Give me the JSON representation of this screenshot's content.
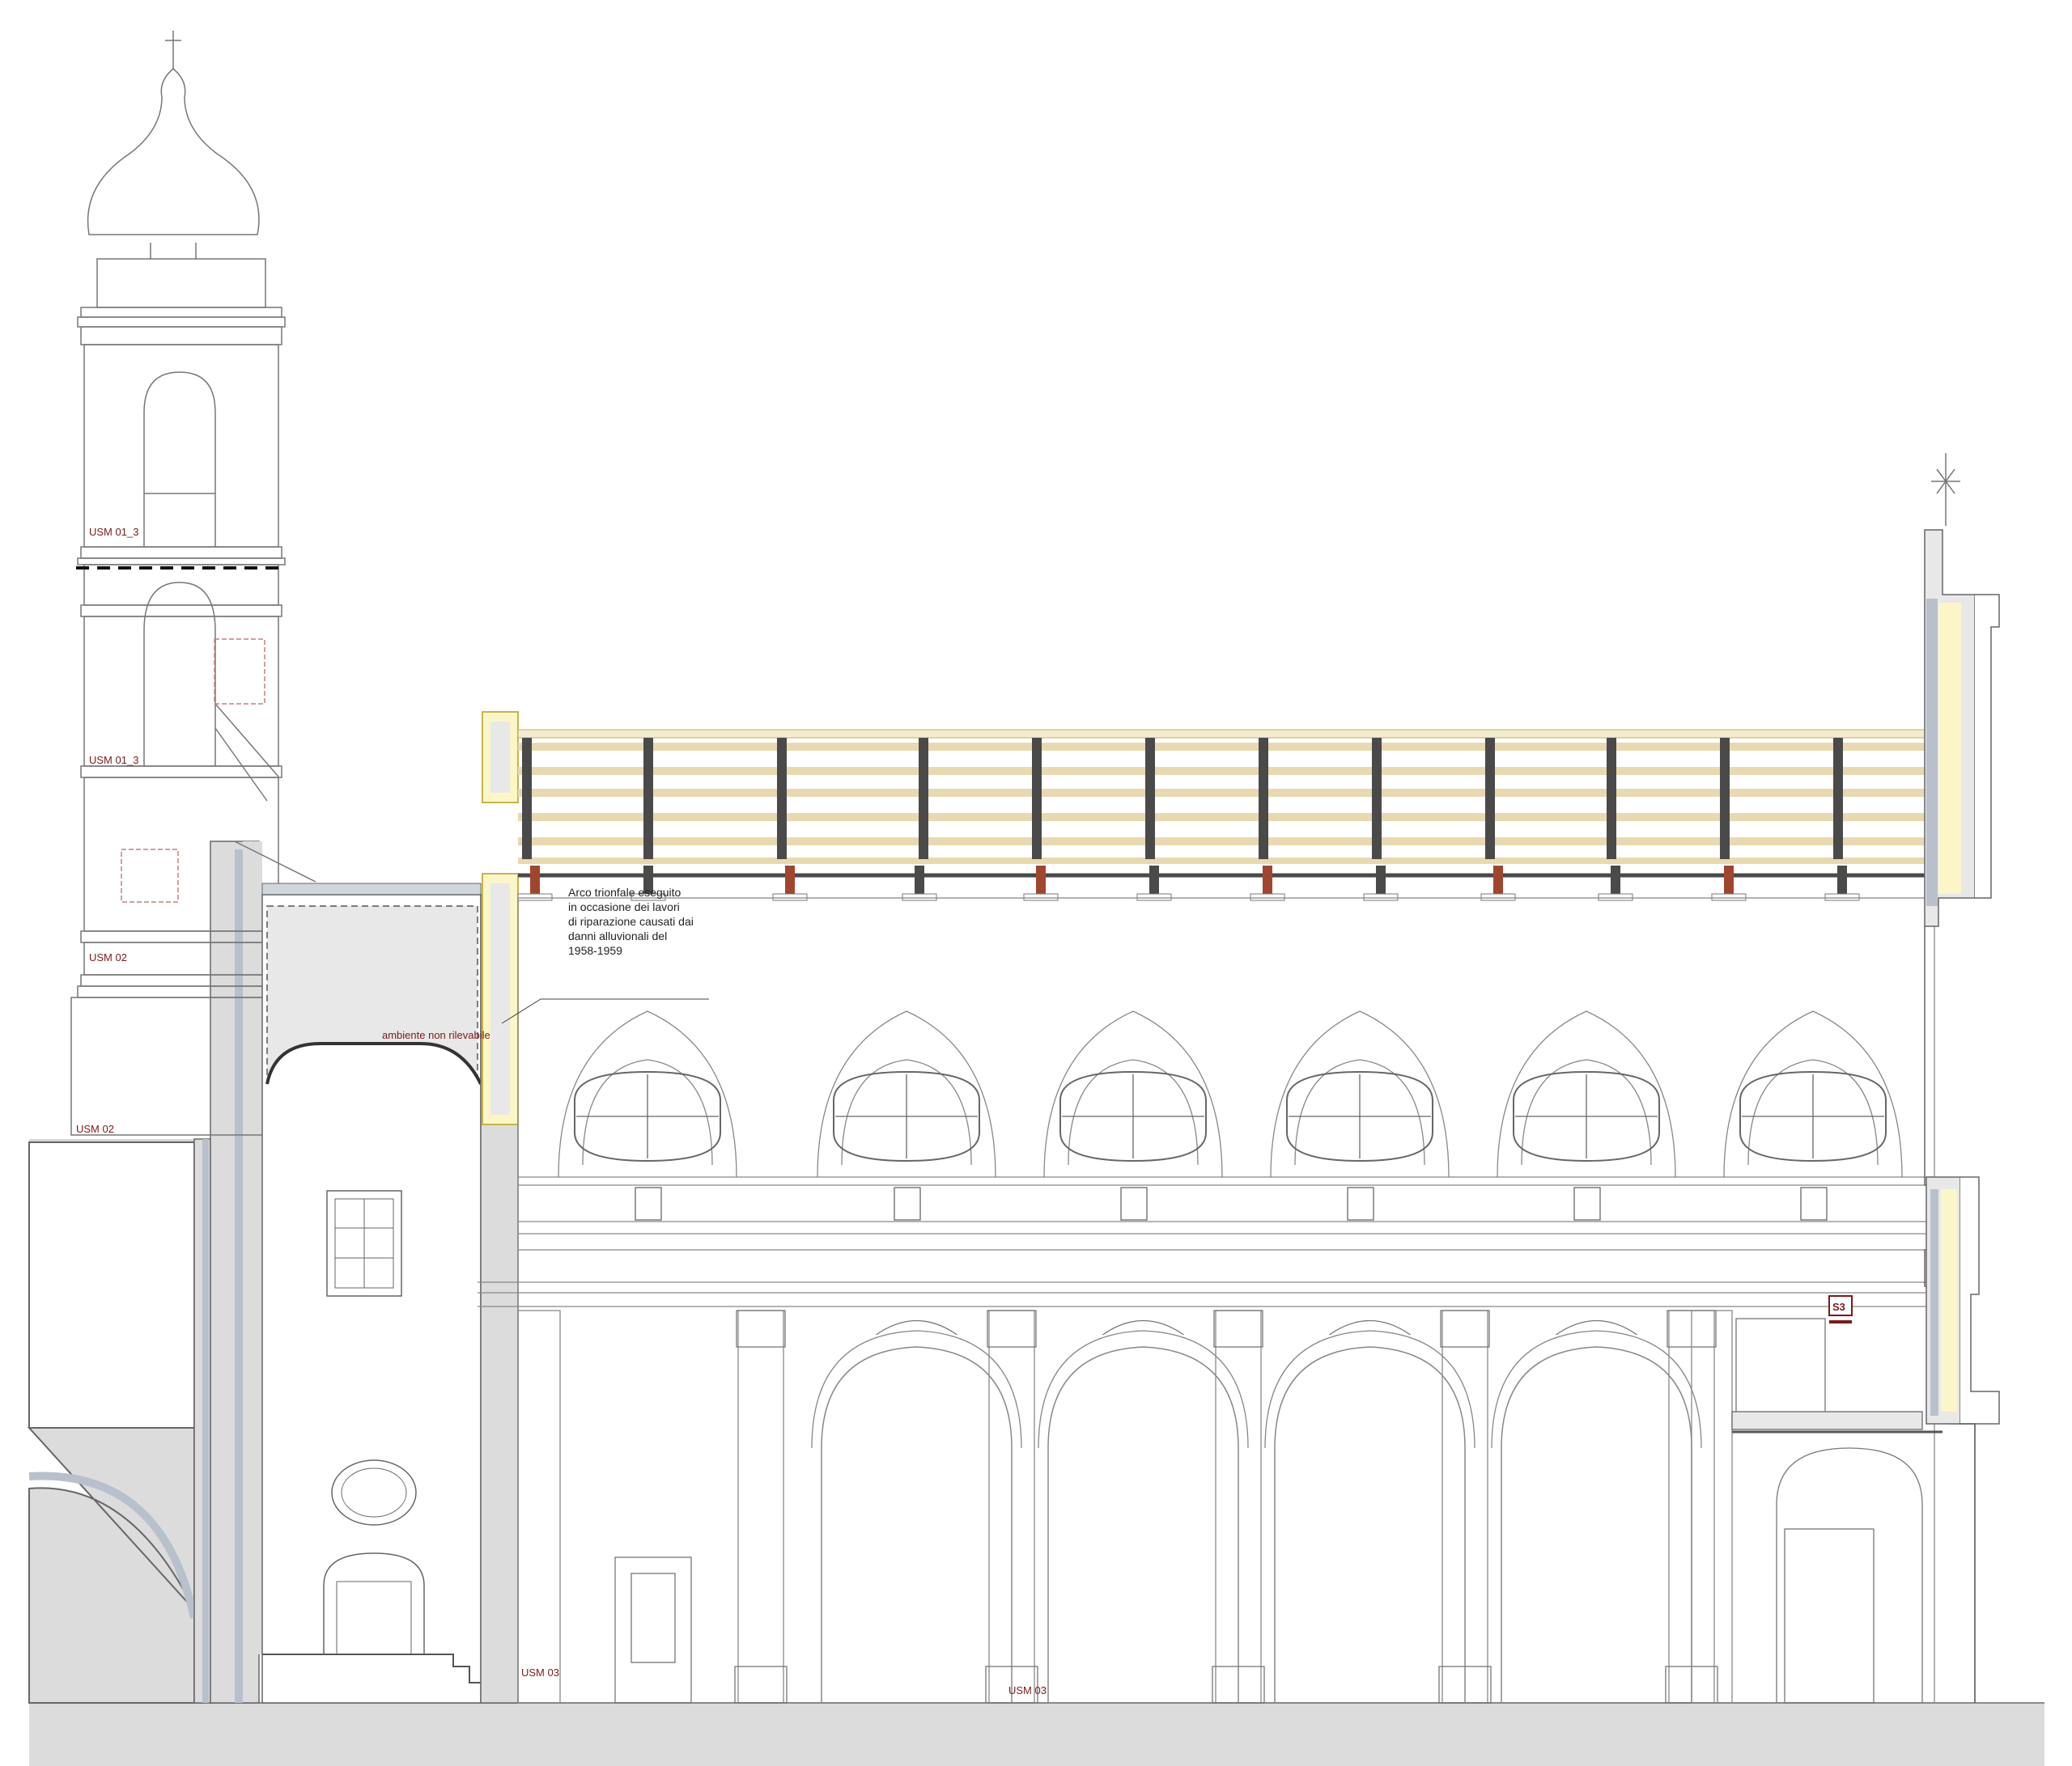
{
  "labels": {
    "usm_01_3_upper": "USM 01_3",
    "usm_01_3_lower": "USM 01_3",
    "usm_02_tower": "USM 02",
    "usm_02_left": "USM 02",
    "usm_03_left": "USM 03",
    "usm_03_center": "USM 03",
    "ambiente": "ambiente non rilevabile",
    "section_tag": "S3"
  },
  "note_lines": [
    "Arco trionfale eseguito",
    "in occasione dei lavori",
    "di riparazione causati dai",
    "danni alluvionali del",
    "1958-1959"
  ],
  "colors": {
    "line": "#555555",
    "ground": "#dcdcdc",
    "wall_section": "#e8e8e8",
    "wall_edge": "#b8c0cc",
    "label_red": "#7a1a1a",
    "yellow_fill": "#fbf6c8",
    "yellow_edge": "#c9b24a",
    "beam_dark": "#4a4a4a",
    "beam_red": "#a0462e",
    "roof_stripe": "#e8d9b0"
  }
}
